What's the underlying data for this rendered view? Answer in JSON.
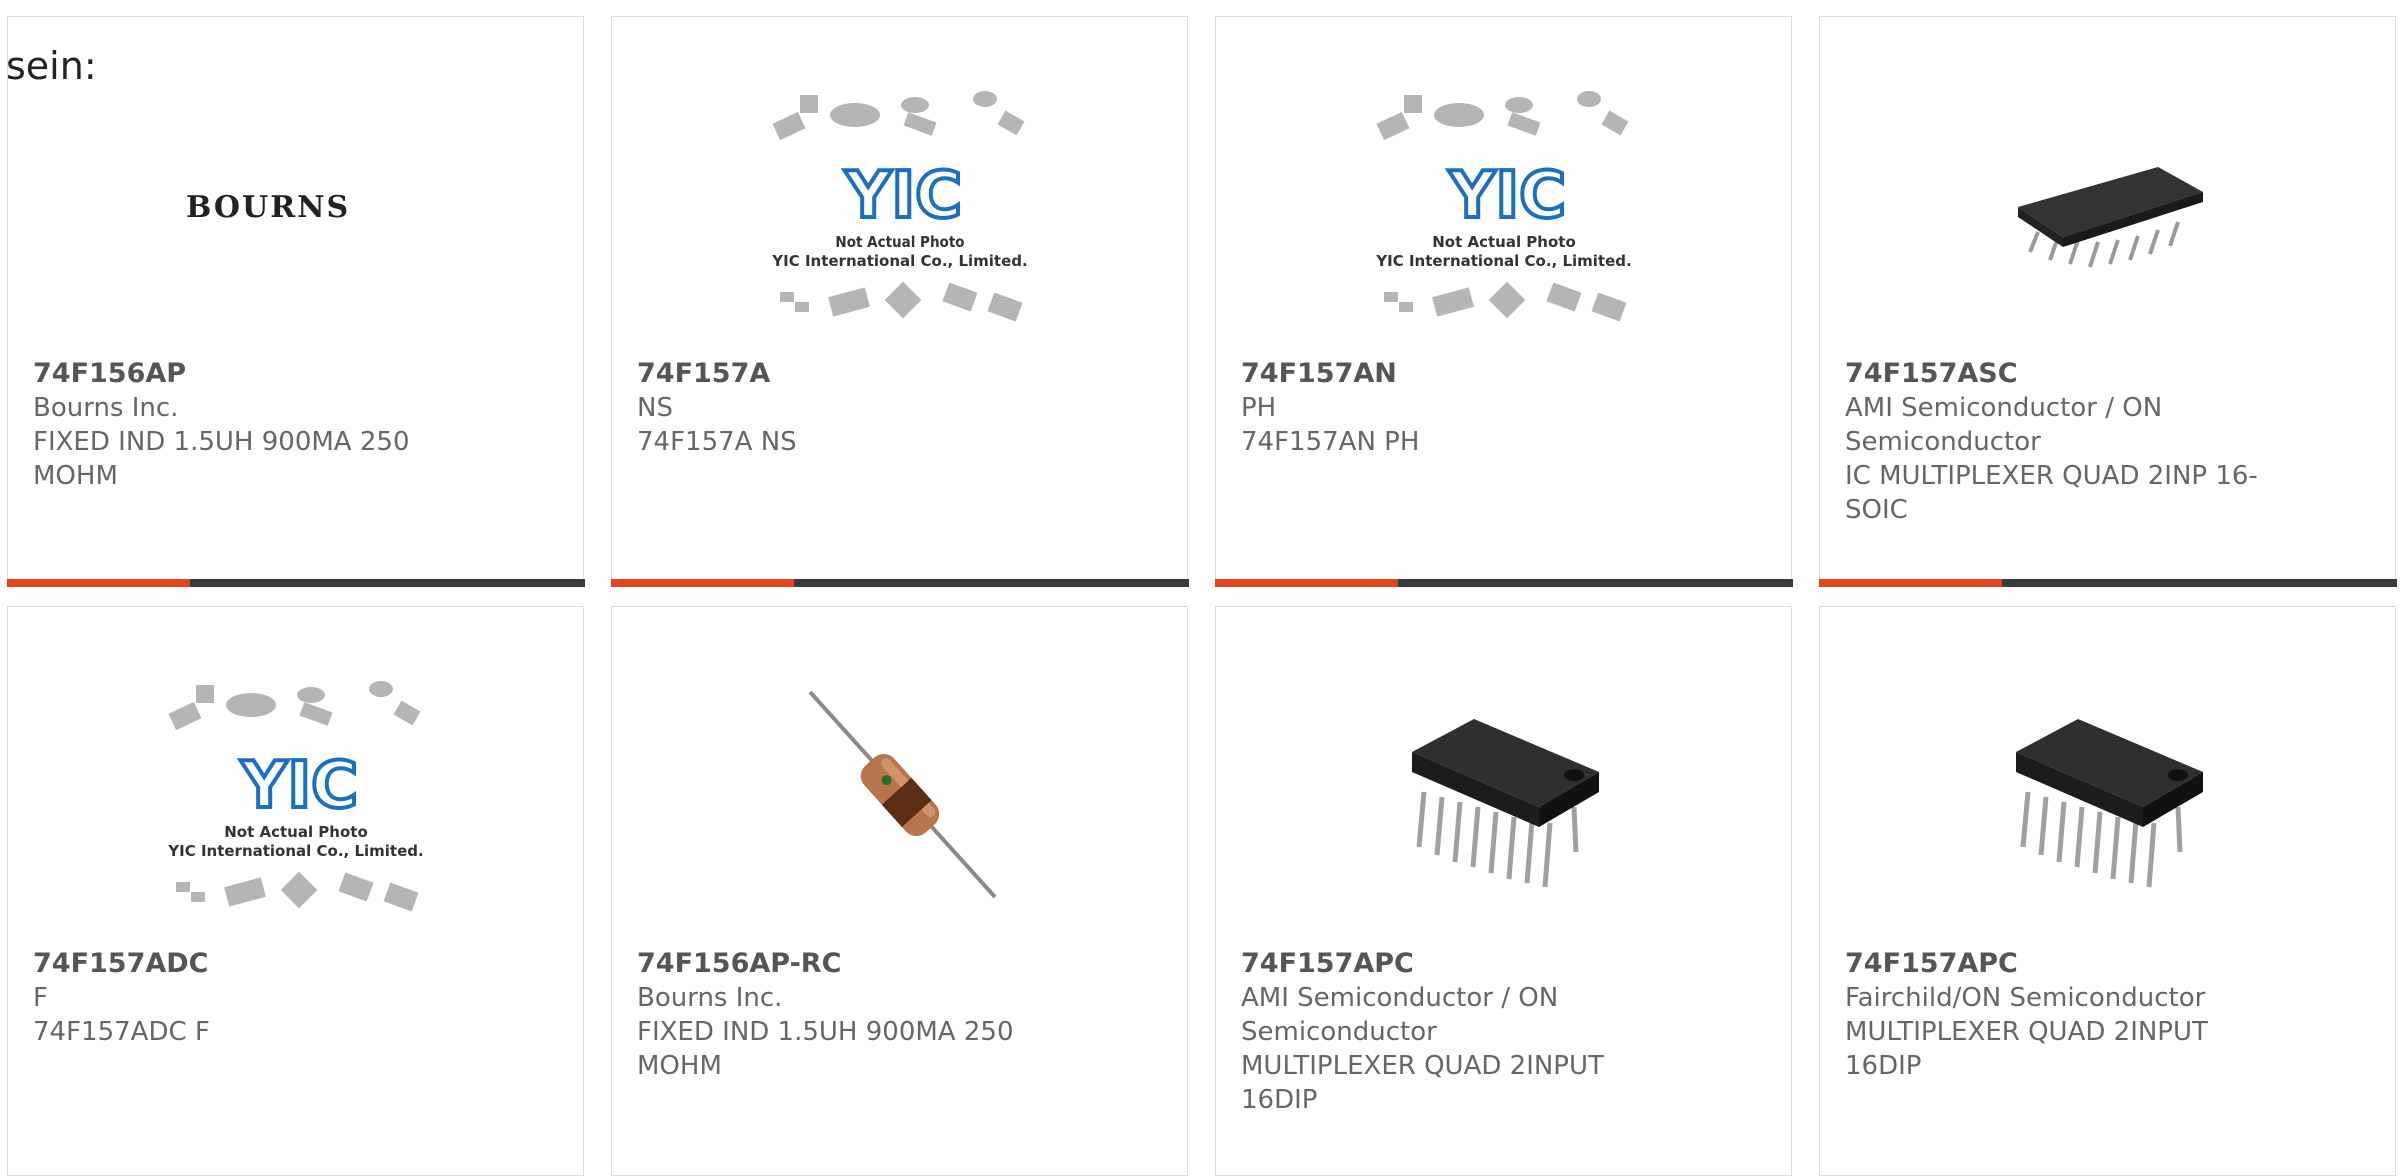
{
  "lead_text": "sein:",
  "yic": {
    "line1": "Not Actual Photo",
    "line2": "YIC International Co., Limited."
  },
  "bourns_logo": "BOURNS",
  "cards": [
    {
      "part": "74F156AP",
      "manufacturer": "Bourns Inc.",
      "description": "FIXED IND 1.5UH 900MA 250 MOHM",
      "image": "bourns-logo"
    },
    {
      "part": "74F157A",
      "manufacturer": "NS",
      "description": "74F157A NS",
      "image": "yic-placeholder"
    },
    {
      "part": "74F157AN",
      "manufacturer": "PH",
      "description": "74F157AN PH",
      "image": "yic-placeholder"
    },
    {
      "part": "74F157ASC",
      "manufacturer": "AMI Semiconductor / ON Semiconductor",
      "description": "IC MULTIPLEXER QUAD 2INP 16-SOIC",
      "image": "soic-chip"
    },
    {
      "part": "74F157ADC",
      "manufacturer": "F",
      "description": "74F157ADC F",
      "image": "yic-placeholder"
    },
    {
      "part": "74F156AP-RC",
      "manufacturer": "Bourns Inc.",
      "description": "FIXED IND 1.5UH 900MA 250 MOHM",
      "image": "axial-inductor"
    },
    {
      "part": "74F157APC",
      "manufacturer": "AMI Semiconductor / ON Semiconductor",
      "description": "MULTIPLEXER QUAD 2INPUT 16DIP",
      "image": "dip-chip"
    },
    {
      "part": "74F157APC",
      "manufacturer": "Fairchild/ON Semiconductor",
      "description": "MULTIPLEXER QUAD 2INPUT 16DIP",
      "image": "dip-chip"
    }
  ],
  "colors": {
    "accent": "#e6431b",
    "bar": "#3a3a3a",
    "border": "#dcdcdc",
    "yic_blue": "#1a6fc0"
  }
}
